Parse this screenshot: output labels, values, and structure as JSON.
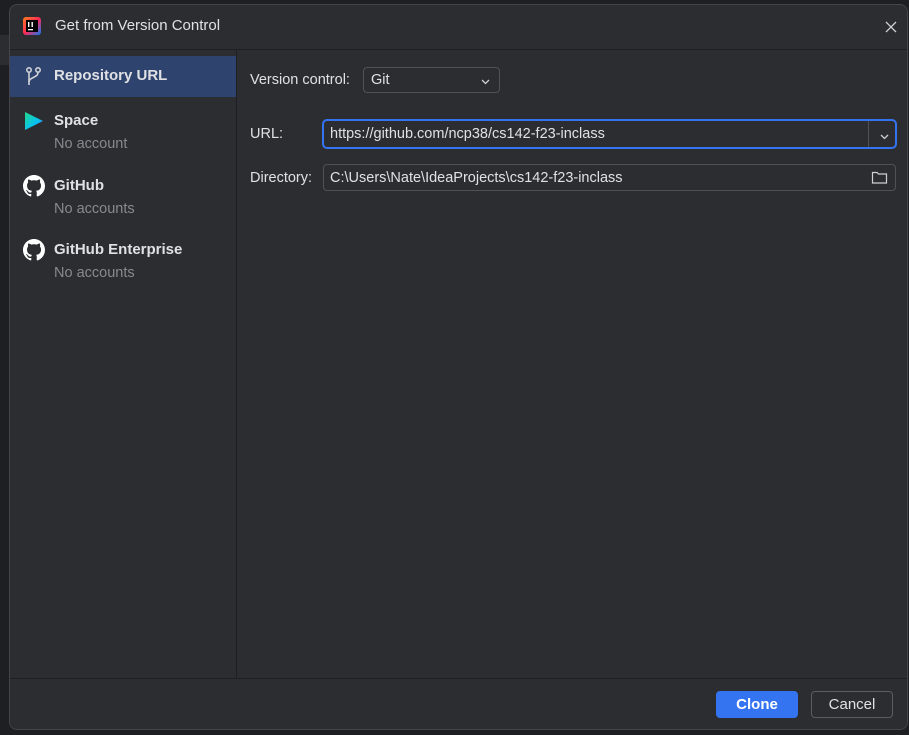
{
  "dialog": {
    "title": "Get from Version Control",
    "close_icon": "close-icon"
  },
  "sidebar": {
    "items": [
      {
        "label": "Repository URL",
        "sub": "",
        "icon": "vcs-branch-icon",
        "selected": true
      },
      {
        "label": "Space",
        "sub": "No account",
        "icon": "space-logo-icon",
        "selected": false
      },
      {
        "label": "GitHub",
        "sub": "No accounts",
        "icon": "github-icon",
        "selected": false
      },
      {
        "label": "GitHub Enterprise",
        "sub": "No accounts",
        "icon": "github-icon",
        "selected": false
      }
    ]
  },
  "form": {
    "vcs_label": "Version control:",
    "vcs_value": "Git",
    "url_label": "URL:",
    "url_value": "https://github.com/ncp38/cs142-f23-inclass",
    "dir_label": "Directory:",
    "dir_value": "C:\\Users\\Nate\\IdeaProjects\\cs142-f23-inclass"
  },
  "footer": {
    "clone_label": "Clone",
    "cancel_label": "Cancel"
  },
  "colors": {
    "accent": "#3574f0",
    "selection": "#2e436e",
    "background": "#2b2d30"
  }
}
